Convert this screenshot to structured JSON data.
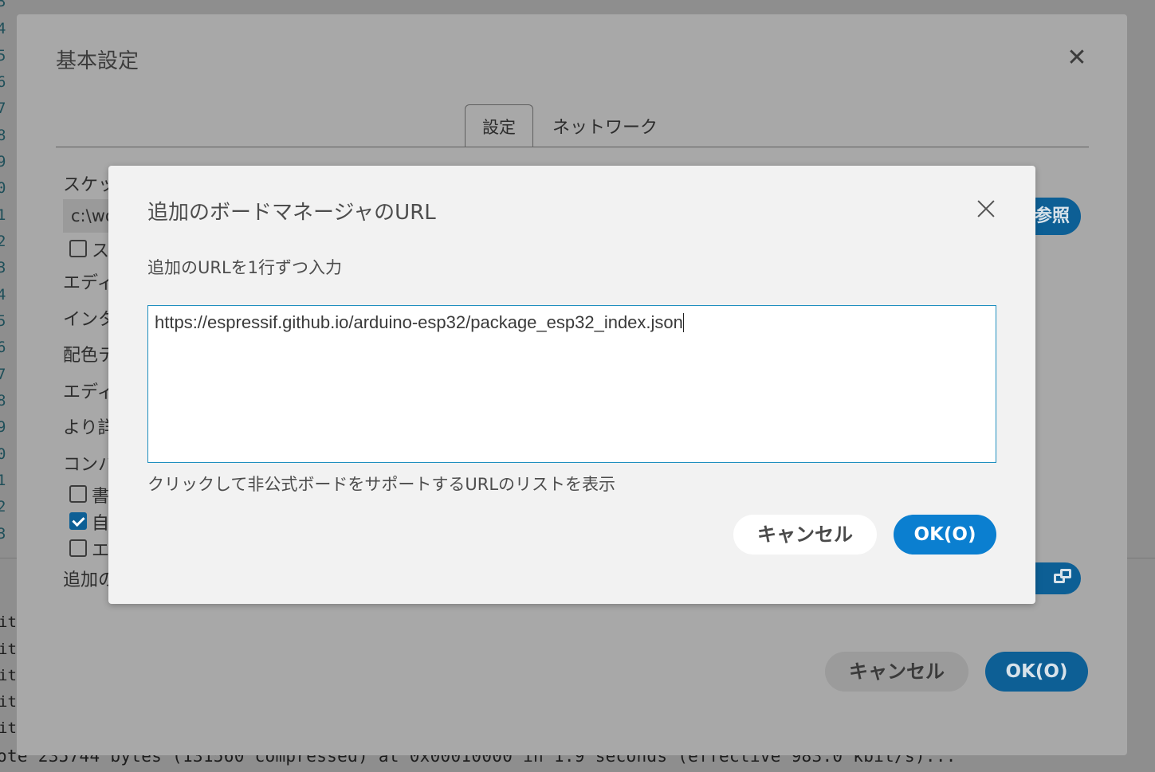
{
  "editor": {
    "line_numbers": [
      "3",
      "4",
      "5",
      "6",
      "7",
      "8",
      "9",
      "0",
      "1",
      "2",
      "3",
      "4",
      "5",
      "6",
      "7",
      "8",
      "9",
      "0",
      "1",
      "2",
      "3"
    ],
    "console_fragments": [
      "it",
      "it",
      "it",
      "it",
      "it"
    ],
    "console_last_line": "ote 235744 bytes (131560 compressed) at 0x00010000 in 1.9 seconds (effective 983.0 kbit/s)..."
  },
  "prefs": {
    "title": "基本設定",
    "tabs": [
      {
        "label": "設定"
      },
      {
        "label": "ネットワーク"
      }
    ],
    "sketchbook_label": "スケッ",
    "sketchbook_value": "c:\\wo",
    "browse_label": "参照",
    "labels": [
      "エディ",
      "インタ",
      "配色テ",
      "エディ",
      "より詳",
      "コンパ"
    ],
    "checkbox_top_label": "ス",
    "checkboxes": [
      {
        "label": "書",
        "checked": false
      },
      {
        "label": "自",
        "checked": true
      },
      {
        "label": "エ",
        "checked": false
      }
    ],
    "additional_urls_label": "追加の",
    "cancel_label": "キャンセル",
    "ok_label": "OK(O)"
  },
  "modal": {
    "title": "追加のボードマネージャのURL",
    "description": "追加のURLを1行ずつ入力",
    "textarea_value": "https://espressif.github.io/arduino-esp32/package_esp32_index.json",
    "link_text": "クリックして非公式ボードをサポートするURLのリストを表示",
    "cancel_label": "キャンセル",
    "ok_label": "OK(O)"
  }
}
